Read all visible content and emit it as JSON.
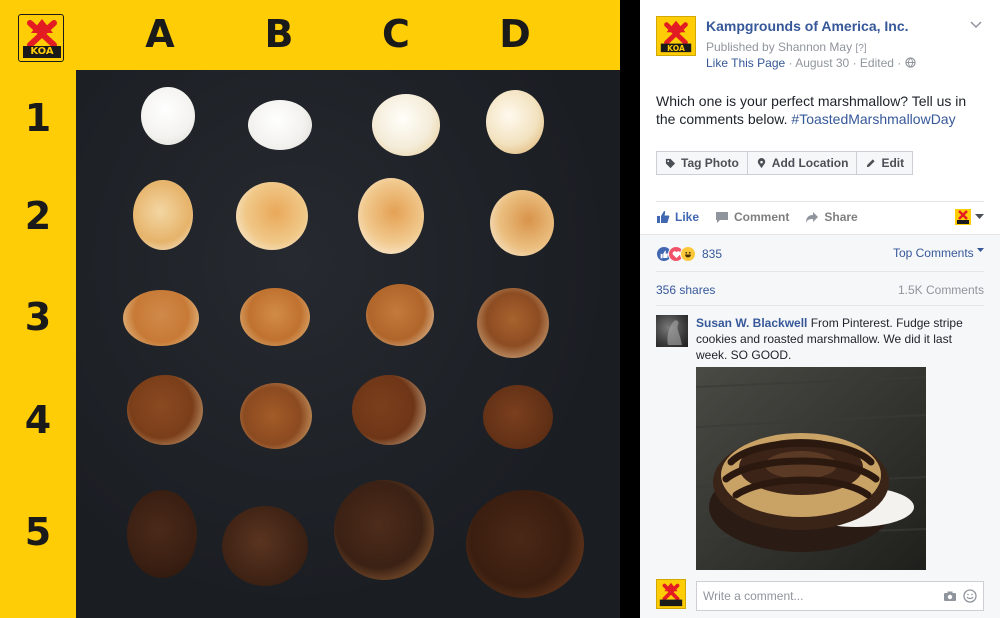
{
  "photo": {
    "columns": [
      "A",
      "B",
      "C",
      "D"
    ],
    "rows": [
      "1",
      "2",
      "3",
      "4",
      "5"
    ],
    "logo_text": "KOA"
  },
  "post": {
    "page_name": "Kampgrounds of America, Inc.",
    "published_by": "Published by Shannon May",
    "published_help": "[?]",
    "like_page": "Like This Page",
    "date": "August 30",
    "edited": "Edited",
    "text": "Which one is your perfect marshmallow? Tell us in the comments below.",
    "hashtag": "#ToastedMarshmallowDay",
    "buttons": {
      "tag_photo": "Tag Photo",
      "add_location": "Add Location",
      "edit": "Edit"
    },
    "actions": {
      "like": "Like",
      "comment": "Comment",
      "share": "Share"
    },
    "reactions_count": "835",
    "top_comments": "Top Comments",
    "shares": "356 shares",
    "comments_count": "1.5K Comments"
  },
  "comment": {
    "author": "Susan W. Blackwell",
    "text": "From Pinterest. Fudge stripe cookies and roasted marshmallow. We did it last week. SO GOOD."
  },
  "composer": {
    "placeholder": "Write a comment..."
  },
  "colors": {
    "koa_yellow": "#ffcd05",
    "fb_blue": "#365899",
    "like_blue": "#4267b2",
    "love_red": "#f25268"
  }
}
